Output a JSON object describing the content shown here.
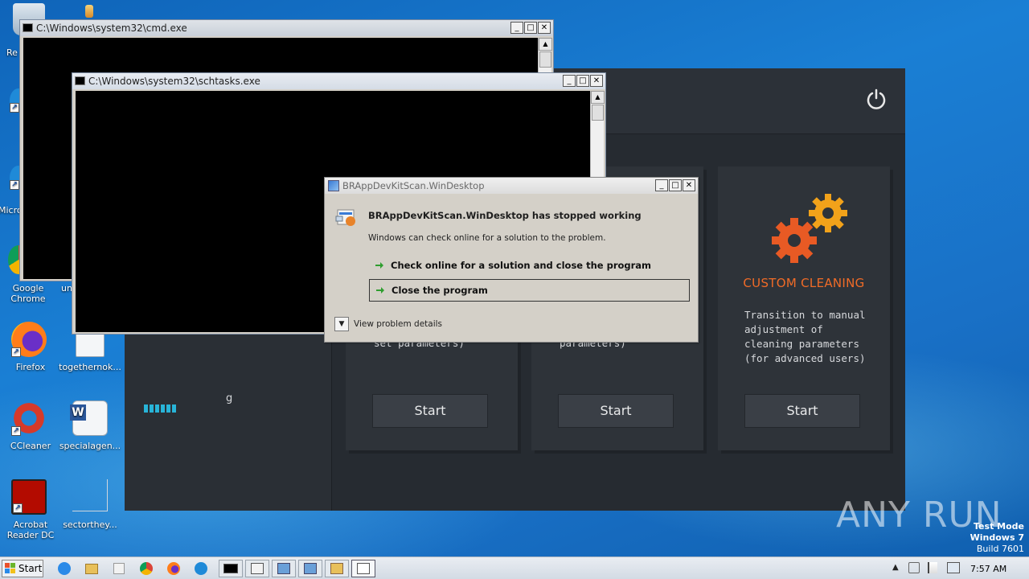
{
  "desktop": {
    "icons": [
      {
        "label": "Re",
        "name": "recycle-bin"
      },
      {
        "label": "Micro",
        "name": "microsoft-edge"
      },
      {
        "label": "Google Chrome",
        "name": "google-chrome"
      },
      {
        "label": "un",
        "name": "unknown-file"
      },
      {
        "label": "Firefox",
        "name": "firefox"
      },
      {
        "label": "togethernok...",
        "name": "togethernok"
      },
      {
        "label": "CCleaner",
        "name": "ccleaner"
      },
      {
        "label": "specialagen...",
        "name": "specialagen"
      },
      {
        "label": "Acrobat Reader DC",
        "name": "acrobat-reader"
      },
      {
        "label": "sectorthey...",
        "name": "sectorthey"
      }
    ]
  },
  "windows": {
    "cmd": {
      "title": "C:\\Windows\\system32\\cmd.exe"
    },
    "schtasks": {
      "title": "C:\\Windows\\system32\\schtasks.exe"
    }
  },
  "app": {
    "cards": [
      {
        "partial_text": "set parameters)",
        "start_label": "Start"
      },
      {
        "partial_text": "parameters)",
        "start_label": "Start"
      },
      {
        "title": "CUSTOM CLEANING",
        "description": "Transition to manual adjustment of cleaning parameters (for advanced users)",
        "start_label": "Start"
      }
    ],
    "left_partial_char": "g",
    "colors": {
      "accent": "#f06b27",
      "progress": "#28b4d8",
      "background": "#262b31"
    }
  },
  "dialog": {
    "title": "BRAppDevKitScan.WinDesktop",
    "heading": "BRAppDevKitScan.WinDesktop has stopped working",
    "message": "Windows can check online for a solution to the problem.",
    "option_check_online": "Check online for a solution and close the program",
    "option_close": "Close the program",
    "details_label": "View problem details"
  },
  "watermark": {
    "text": "ANY RUN"
  },
  "testmode": {
    "line1": "Test Mode",
    "line2": "Windows 7",
    "line3": "Build 7601"
  },
  "taskbar": {
    "start_label": "Start",
    "clock": "7:57 AM"
  }
}
